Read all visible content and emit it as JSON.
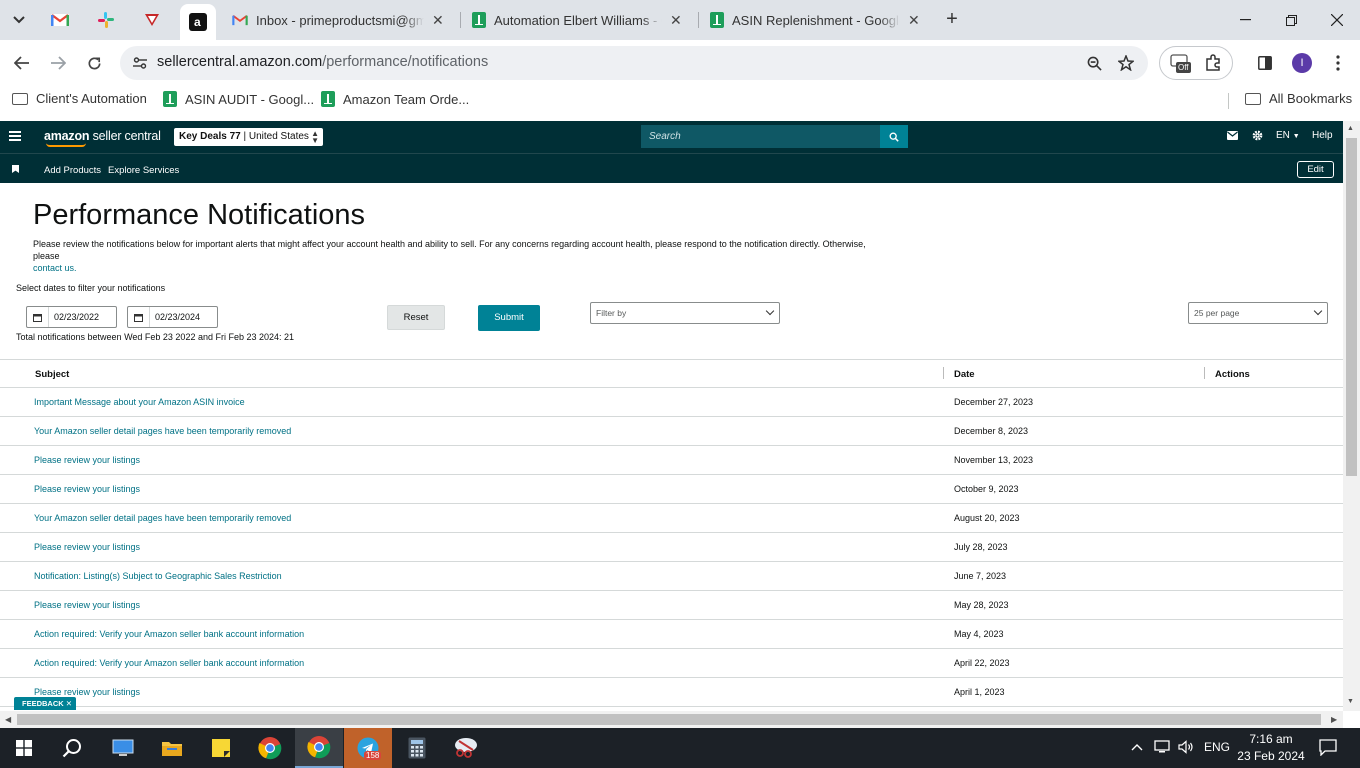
{
  "browser": {
    "tabs": [
      {
        "title": "Inbox - primeproductsmi@gmail.com",
        "icon": "gmail-icon"
      },
      {
        "title": "Automation Elbert Williams - Google Sheets",
        "icon": "sheets-icon"
      },
      {
        "title": "ASIN Replenishment - Google Sheets",
        "icon": "sheets-icon"
      }
    ],
    "url_host": "sellercentral.amazon.com",
    "url_path": "/performance/notifications",
    "ext_badge": "Off",
    "profile_initial": "I",
    "bookmarks": [
      {
        "label": "Client's Automation",
        "icon": "folder-icon"
      },
      {
        "label": "ASIN AUDIT - Googl...",
        "icon": "sheets-icon"
      },
      {
        "label": "Amazon Team Orde...",
        "icon": "sheets-icon"
      }
    ],
    "all_bookmarks": "All Bookmarks"
  },
  "header": {
    "logo_main": "amazon",
    "logo_sub": " seller central",
    "account_store": "Key Deals 77",
    "account_region": " | United States",
    "search_placeholder": "Search",
    "language": "EN",
    "help": "Help"
  },
  "nav": {
    "links": [
      "Add Products",
      "Explore Services"
    ],
    "edit": "Edit"
  },
  "page": {
    "title": "Performance Notifications",
    "description": "Please review the notifications below for important alerts that might affect your account health and ability to sell. For any concerns regarding account health, please respond to the notification directly. Otherwise, please",
    "contact_link": "contact us.",
    "filter_label": "Select dates to filter your notifications",
    "date_from": "02/23/2022",
    "date_to": "02/23/2024",
    "reset": "Reset",
    "submit": "Submit",
    "filter_by": "Filter by",
    "per_page": "25 per page",
    "total": "Total notifications between Wed Feb 23 2022 and Fri Feb 23 2024: 21"
  },
  "table": {
    "headers": {
      "subject": "Subject",
      "date": "Date",
      "actions": "Actions"
    },
    "rows": [
      {
        "subject": "Important Message about your Amazon ASIN invoice",
        "date": "December 27, 2023"
      },
      {
        "subject": "Your Amazon seller detail pages have been temporarily removed",
        "date": "December 8, 2023"
      },
      {
        "subject": "Please review your listings",
        "date": "November 13, 2023"
      },
      {
        "subject": "Please review your listings",
        "date": "October 9, 2023"
      },
      {
        "subject": "Your Amazon seller detail pages have been temporarily removed",
        "date": "August 20, 2023"
      },
      {
        "subject": "Please review your listings",
        "date": "July 28, 2023"
      },
      {
        "subject": "Notification: Listing(s) Subject to Geographic Sales Restriction",
        "date": "June 7, 2023"
      },
      {
        "subject": "Please review your listings",
        "date": "May 28, 2023"
      },
      {
        "subject": "Action required: Verify your Amazon seller bank account information",
        "date": "May 4, 2023"
      },
      {
        "subject": "Action required: Verify your Amazon seller bank account information",
        "date": "April 22, 2023"
      },
      {
        "subject": "Please review your listings",
        "date": "April 1, 2023"
      }
    ]
  },
  "feedback": "FEEDBACK",
  "taskbar": {
    "telegram_badge": "158",
    "language": "ENG",
    "time": "7:16 am",
    "date": "23 Feb 2024"
  },
  "colors": {
    "header_bg": "#002f36",
    "link": "#007185",
    "submit": "#008296"
  }
}
